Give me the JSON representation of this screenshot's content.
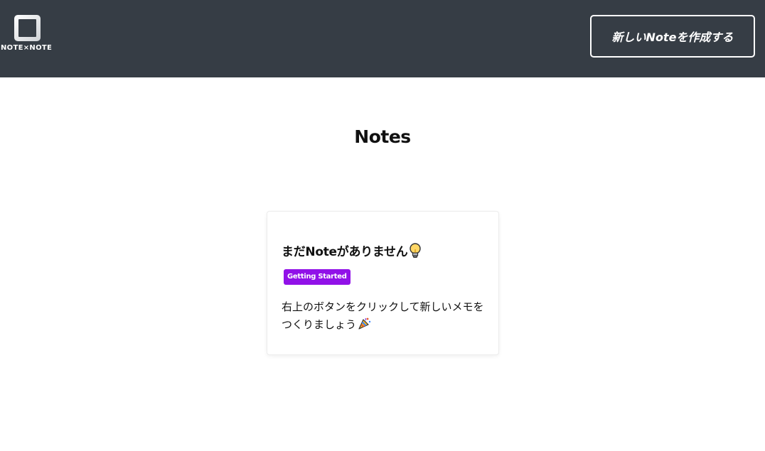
{
  "header": {
    "logo_text": "NOTE×NOTE",
    "logo_icon": "square-frame-logo-icon",
    "new_note_button_label": "新しいNoteを作成する",
    "background_color": "#363d45"
  },
  "main": {
    "page_title": "Notes",
    "card": {
      "title": "まだNoteがありません",
      "title_icon": "lightbulb-icon",
      "tag": "Getting Started",
      "tag_color": "#9111e8",
      "body": "右上のボタンをクリックして新しいメモをつくりましょう",
      "body_icon": "party-popper-icon"
    }
  }
}
